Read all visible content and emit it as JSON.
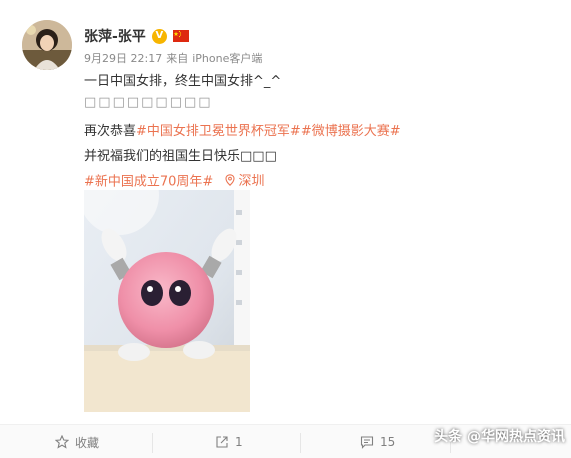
{
  "post": {
    "username": "张萍-张平",
    "verified_badge": "V",
    "flag_icon": "china-flag-icon",
    "timestamp": "9月29日 22:17",
    "source_prefix": "来自",
    "source": "iPhone客户端",
    "line1": "一日中国女排，终生中国女排^_^",
    "line2": "□□□□□□□□□",
    "line3_prefix": "再次恭喜",
    "tag1": "#中国女排卫冕世界杯冠军#",
    "tag2": "#微博摄影大赛#",
    "line4": "并祝福我们的祖国生日快乐□□□",
    "tag3": "#新中国成立70周年#",
    "location": "深圳"
  },
  "actions": {
    "favorite_label": "收藏",
    "repost_count": "1",
    "comment_count": "15"
  },
  "watermark": "头条 @华网热点资讯",
  "colors": {
    "accent": "#eb7350",
    "verified": "#f7b500",
    "text": "#333333",
    "meta": "#8a8a8a"
  }
}
